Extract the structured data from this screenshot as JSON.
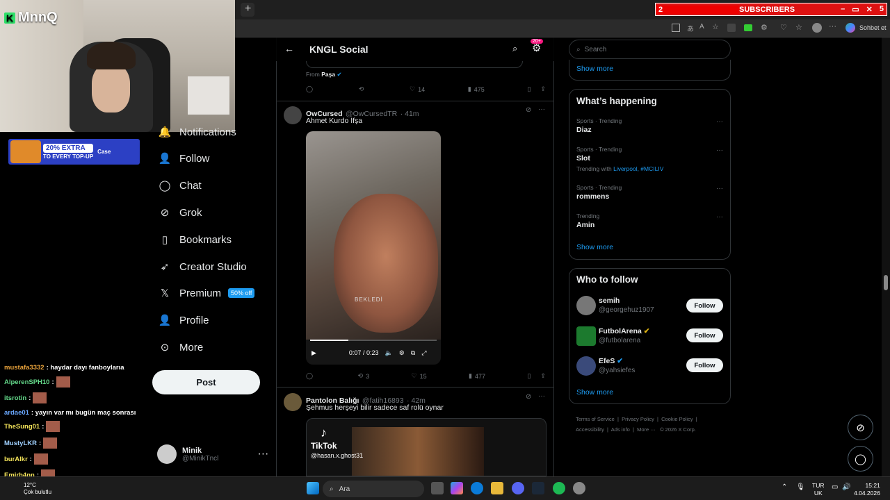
{
  "overlay": {
    "logo_text": "MnnQ",
    "logo_letter": "K",
    "subscribers": {
      "count": "2",
      "label": "SUBSCRIBERS",
      "goal": "5"
    },
    "promo": {
      "text": "20% EXTRA",
      "sub": "TO EVERY TOP-UP",
      "brand": "Case"
    }
  },
  "browser": {
    "copilot_label": "Sohbet et",
    "new_tab": "+"
  },
  "nav": {
    "items": [
      {
        "label": "Notifications"
      },
      {
        "label": "Follow"
      },
      {
        "label": "Chat"
      },
      {
        "label": "Grok"
      },
      {
        "label": "Bookmarks"
      },
      {
        "label": "Creator Studio"
      },
      {
        "label": "Premium",
        "badge": "50% off"
      },
      {
        "label": "Profile"
      },
      {
        "label": "More"
      }
    ],
    "post_label": "Post",
    "user": {
      "name": "Minik",
      "handle": "@MinikTncl"
    }
  },
  "header": {
    "title": "KNGL Social",
    "notif_badge": "20+"
  },
  "tweets": [
    {
      "from_label": "From",
      "from_name": "Paşa",
      "replies": "",
      "reposts": "",
      "likes": "14",
      "views": "475"
    },
    {
      "name": "OwCursed",
      "handle": "@OwCursedTR",
      "time": "· 41m",
      "text": "Ahmet Kurdo İfşa",
      "video_time": "0:07 / 0:23",
      "video_progress": 0.3,
      "watermark": "BEKLEDİ",
      "replies": "",
      "reposts": "3",
      "likes": "15",
      "views": "477"
    },
    {
      "name": "Pantolon Balığı",
      "handle": "@fatih16893",
      "time": "· 42m",
      "text": "Şehmus herşeyi bilir sadece saf rolü oynar",
      "media_brand": "TikTok",
      "media_handle": "@hasan.x.ghost31"
    }
  ],
  "sidebar": {
    "search_placeholder": "Search",
    "show_more": "Show more",
    "happening_title": "What’s happening",
    "trends": [
      {
        "meta": "Sports · Trending",
        "name": "Diaz"
      },
      {
        "meta": "Sports · Trending",
        "name": "Slot",
        "extra_prefix": "Trending with",
        "extra_links": "Liverpool, #MCILIV"
      },
      {
        "meta": "Sports · Trending",
        "name": "rommens"
      },
      {
        "meta": "Trending",
        "name": "Amin"
      }
    ],
    "wtf_title": "Who to follow",
    "follow_label": "Follow",
    "wtf": [
      {
        "name": "semih",
        "handle": "@georgehuz1907"
      },
      {
        "name": "FutbolArena",
        "handle": "@futbolarena"
      },
      {
        "name": "EfeS",
        "handle": "@yahsiefes"
      }
    ],
    "footer": [
      "Terms of Service",
      "Privacy Policy",
      "Cookie Policy",
      "Accessibility",
      "Ads info",
      "More ···",
      "© 2026 X Corp."
    ]
  },
  "chat": [
    {
      "user": "mustafa3332",
      "msg": ": haydar dayı fanboylarıa"
    },
    {
      "user": "AlperenSPH10",
      "msg": ":"
    },
    {
      "user": "itsrotin",
      "msg": ":"
    },
    {
      "user": "ardae01",
      "msg": ": yayın var mı bugün maç sonrası"
    },
    {
      "user": "TheSung01",
      "msg": ":"
    },
    {
      "user": "MustyLKR",
      "msg": ":"
    },
    {
      "user": "burAlkr",
      "msg": ":"
    },
    {
      "user": "Emirh4nn",
      "msg": ":"
    }
  ],
  "taskbar": {
    "search": "Ara",
    "weather_temp": "12°C",
    "weather_text": "Çok bulutlu",
    "lang_top": "TUR",
    "lang_bottom": "UK",
    "time": "15:21",
    "date": "4.04.2026"
  },
  "colors": {
    "accent": "#1d9bf0",
    "subs_bar": "#dd1111",
    "promo": "#2c40c4"
  }
}
